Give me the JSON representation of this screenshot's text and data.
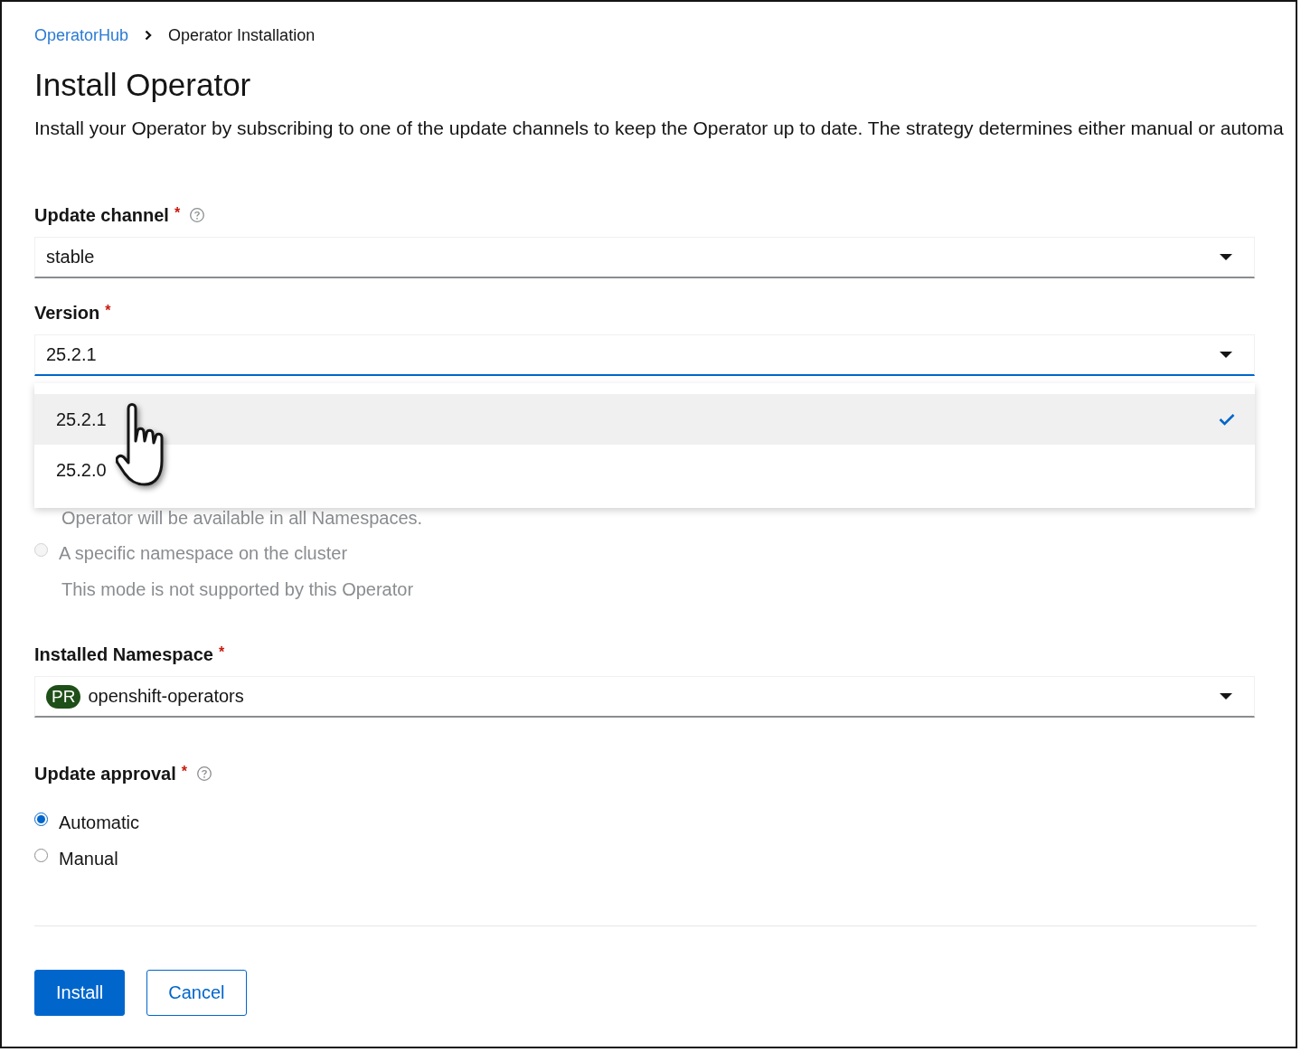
{
  "breadcrumb": [
    {
      "label": "OperatorHub",
      "link": true
    },
    {
      "label": "Operator Installation",
      "link": false
    }
  ],
  "title": "Install Operator",
  "description": "Install your Operator by subscribing to one of the update channels to keep the Operator up to date. The strategy determines either manual or automa",
  "update_channel": {
    "label": "Update channel",
    "required_mark": "*",
    "help": true,
    "value": "stable"
  },
  "version": {
    "label": "Version",
    "required_mark": "*",
    "value": "25.2.1",
    "focused": true,
    "open": true,
    "options": [
      {
        "label": "25.2.1",
        "selected": true
      },
      {
        "label": "25.2.0",
        "selected": false
      }
    ]
  },
  "installation_mode": {
    "note": "Operator will be available in all Namespaces.",
    "options": [
      {
        "label": "A specific namespace on the cluster",
        "selected": false,
        "disabled": true,
        "note": "This mode is not supported by this Operator"
      }
    ]
  },
  "installed_namespace": {
    "label": "Installed Namespace",
    "required_mark": "*",
    "badge": "PR",
    "value": "openshift-operators"
  },
  "update_approval": {
    "label": "Update approval",
    "required_mark": "*",
    "help": true,
    "options": [
      {
        "label": "Automatic",
        "selected": true,
        "disabled": false
      },
      {
        "label": "Manual",
        "selected": false,
        "disabled": false
      }
    ]
  },
  "buttons": [
    {
      "label": "Install",
      "kind": "primary"
    },
    {
      "label": "Cancel",
      "kind": "secondary"
    }
  ]
}
